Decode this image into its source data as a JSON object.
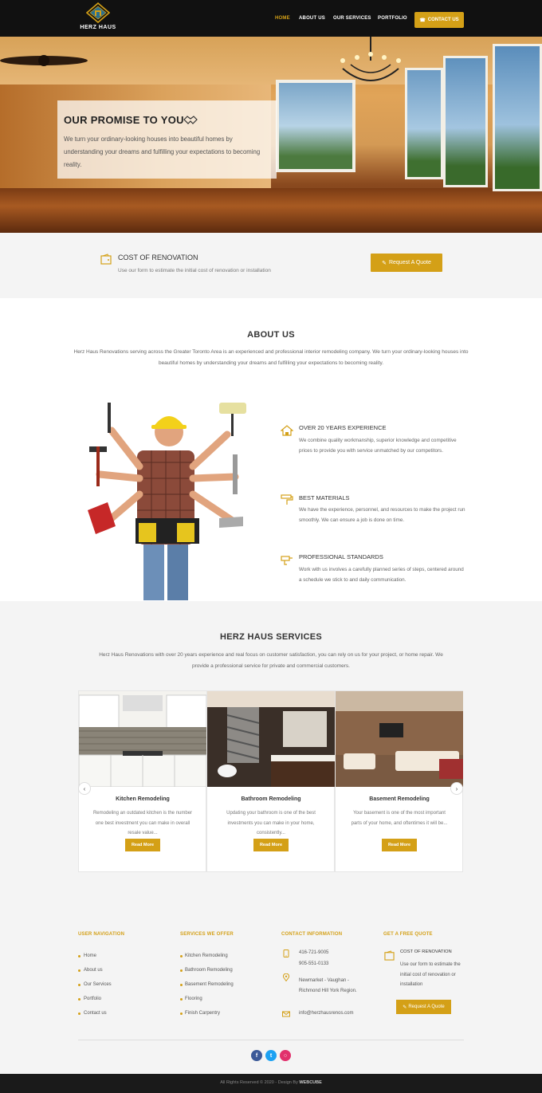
{
  "header": {
    "logo_text": "HERZ HAUS",
    "nav": [
      "HOME",
      "ABOUT US",
      "OUR SERVICES",
      "PORTFOLIO"
    ],
    "contact_label": "CONTACT US",
    "accent": "#d4a017"
  },
  "hero": {
    "title": "OUR PROMISE TO YOU",
    "text": "We turn your ordinary-looking houses into beautiful homes by understanding your dreams and fulfilling your expectations to becoming reality."
  },
  "cost": {
    "title": "COST OF RENOVATION",
    "text": "Use our form to estimate the initial cost of renovation or installation",
    "button": "Request A Quote"
  },
  "about": {
    "title": "ABOUT US",
    "text": "Herz Haus Renovations serving across the Greater Toronto Area is an experienced and professional interior remodeling company. We turn your ordinary-looking houses into beautiful homes by understanding your dreams and fulfilling your expectations to becoming reality.",
    "features": [
      {
        "title": "OVER 20 YEARS EXPERIENCE",
        "text": "We combine quality workmanship, superior knowledge and competitive prices to provide you with service unmatched by our competitors."
      },
      {
        "title": "BEST MATERIALS",
        "text": "We have the experience, personnel, and resources to make the project run smoothly. We can ensure a job is done on time."
      },
      {
        "title": "PROFESSIONAL STANDARDS",
        "text": "Work with us involves a carefully planned series of steps, centered around a schedule we stick to and daily communication."
      }
    ]
  },
  "services": {
    "title": "HERZ HAUS SERVICES",
    "text": "Herz Haus Renovations with over 20 years experience and real focus on customer satisfaction, you can rely on us for your project, or home repair. We provide a professional service for private and commercial customers.",
    "cards": [
      {
        "title": "Kitchen Remodeling",
        "text": "Remodeling an outdated kitchen is the number one best investment you can make in overall resale value...",
        "button": "Read More"
      },
      {
        "title": "Bathroom Remodeling",
        "text": "Updating your bathroom is one of the best investments you can make in your home, consistently...",
        "button": "Read More"
      },
      {
        "title": "Basement Remodeling",
        "text": "Your basement is one of the most important parts of your home, and oftentimes it will be...",
        "button": "Read More"
      }
    ]
  },
  "footer": {
    "nav_head": "USER NAVIGATION",
    "nav_items": [
      "Home",
      "About us",
      "Our Services",
      "Portfolio",
      "Contact us"
    ],
    "services_head": "SERVICES WE OFFER",
    "services_items": [
      "Kitchen Remodeling",
      "Bathroom Remodeling",
      "Basement Remodeling",
      "Flooring",
      "Finish Carpentry"
    ],
    "contact_head": "CONTACT INFORMATION",
    "phone1": "416-721-9005",
    "phone2": "905-551-0133",
    "address": "Newmarket - Vaughan - Richmond Hill York Region.",
    "email": "info@herzhausrenos.com",
    "quote_head": "GET A FREE QUOTE",
    "quote_title": "COST OF RENOVATION",
    "quote_text": "Use our form to estimate the initial cost of renovation or installation",
    "quote_button": "Request A Quote",
    "copyright": "All Rights Reserved © 2020 - Design By",
    "designer": "WEBCUBE"
  }
}
